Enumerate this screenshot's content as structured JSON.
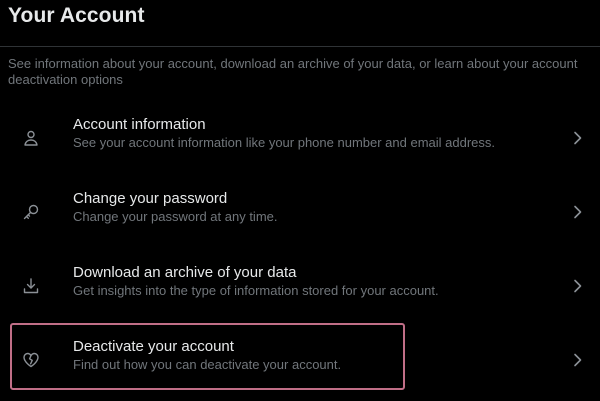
{
  "page": {
    "title": "Your Account",
    "intro": "See information about your account, download an archive of your data, or learn about your account deactivation options"
  },
  "items": [
    {
      "label": "Account information",
      "description": "See your account information like your phone number and email address.",
      "icon": "person-icon"
    },
    {
      "label": "Change your password",
      "description": "Change your password at any time.",
      "icon": "key-icon"
    },
    {
      "label": "Download an archive of your data",
      "description": "Get insights into the type of information stored for your account.",
      "icon": "download-icon"
    },
    {
      "label": "Deactivate your account",
      "description": "Find out how you can deactivate your account.",
      "icon": "broken-heart-icon"
    }
  ],
  "colors": {
    "background": "#000000",
    "text_primary": "#e7e9ea",
    "text_secondary": "#71767b",
    "divider": "#2f3336",
    "highlight": "#c06e87"
  }
}
